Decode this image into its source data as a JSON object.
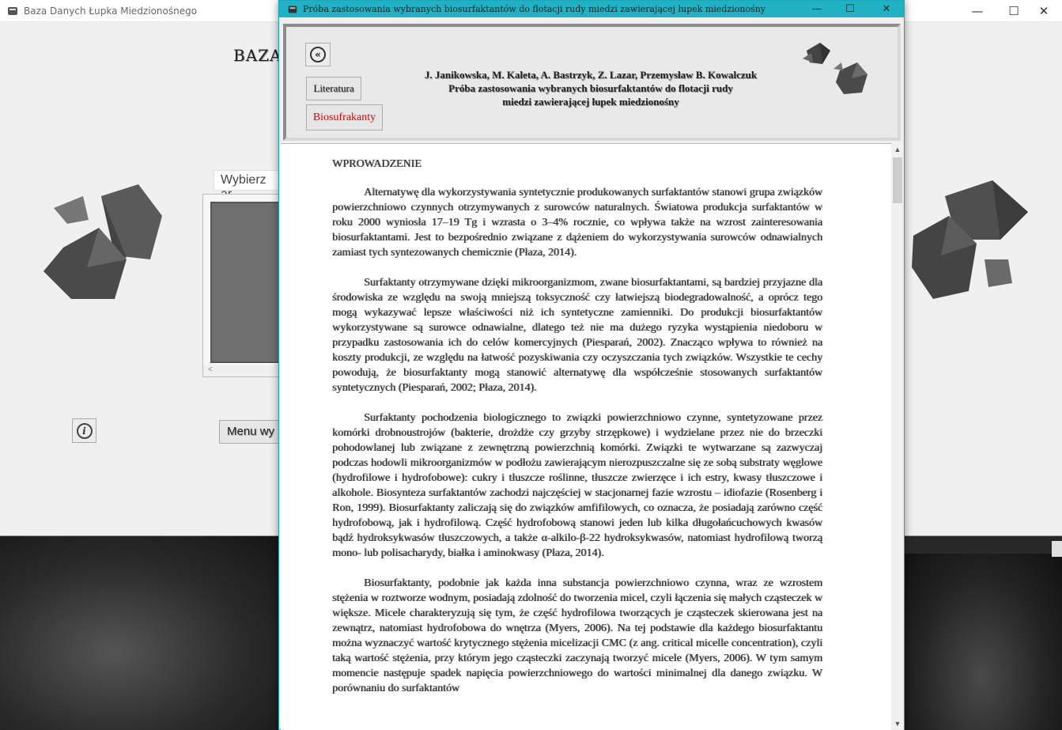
{
  "background_app": {
    "title": "Baza Danych Łupka Miedzionośnego",
    "heading": "BAZA",
    "select_text": "Wybierz ar",
    "menu_button": "Menu wy",
    "minimize": "—",
    "maximize": "☐",
    "close": "✕"
  },
  "dialog": {
    "title": "Próba zastosowania wybranych biosurfaktantów do flotacji rudy miedzi zawierającej łupek miedzionośny",
    "minimize": "—",
    "maximize": "☐",
    "close": "✕",
    "back_glyph": "«",
    "literatura_button": "Literatura",
    "biosurfaktanty_button": "Biosufrakanty",
    "authors": "J. Janikowska, M. Kaleta, A. Bastrzyk, Z. Lazar, Przemysław B. Kowalczuk",
    "paper_title_line1": "Próba zastosowania wybranych biosurfaktantów do flotacji rudy",
    "paper_title_line2": "miedzi zawierającej łupek miedzionośny",
    "accent_color": "#20b2c4"
  },
  "document": {
    "heading": "WPROWADZENIE",
    "paragraphs": [
      "Alternatywę dla wykorzystywania syntetycznie produkowanych surfaktantów stanowi grupa związków powierzchniowo czynnych otrzymywanych z surowców naturalnych. Światowa produkcja surfaktantów w roku 2000 wyniosła 17–19 Tg i wzrasta o 3–4% rocznie, co wpływa także na wzrost zainteresowania biosurfaktantami. Jest to bezpośrednio związane z dążeniem do wykorzystywania surowców odnawialnych zamiast tych syntezowanych chemicznie (Płaza, 2014).",
      "Surfaktanty otrzymywane dzięki mikroorganizmom, zwane biosurfaktantami, są bardziej przyjazne dla środowiska ze względu na swoją mniejszą toksyczność czy łatwiejszą biodegradowalność, a oprócz tego mogą wykazywać lepsze właściwości niż ich syntetyczne zamienniki. Do produkcji biosurfaktantów wykorzystywane są surowce odnawialne, dlatego też nie ma dużego ryzyka wystąpienia niedoboru w przypadku zastosowania ich do celów komercyjnych (Piesparań, 2002). Znacząco wpływa to również na koszty produkcji, ze względu na łatwość pozyskiwania czy oczyszczania tych związków. Wszystkie te cechy powodują, że biosurfaktanty mogą stanowić alternatywę dla współcześnie stosowanych surfaktantów syntetycznych (Piesparań, 2002; Płaza, 2014).",
      "Surfaktanty pochodzenia biologicznego to związki powierzchniowo czynne, syntetyzowane przez komórki drobnoustrojów (bakterie, drożdże czy grzyby strzępkowe) i wydzielane przez nie do brzeczki pohodowlanej lub związane z zewnętrzną powierzchnią komórki. Związki te wytwarzane są zazwyczaj podczas hodowli mikroorganizmów w podłożu zawierającym nierozpuszczalne się ze sobą substraty węglowe (hydrofilowe i hydrofobowe): cukry i tłuszcze roślinne, tłuszcze zwierzęce i ich estry, kwasy tłuszczowe i alkohole. Biosynteza surfaktantów zachodzi najczęściej w stacjonarnej fazie wzrostu – idiofazie (Rosenberg i Ron, 1999). Biosurfaktanty zaliczają się do związków amfifilowych, co oznacza, że posiadają zarówno część hydrofobową, jak i hydrofilową. Część hydrofobową stanowi jeden lub kilka długołańcuchowych kwasów bądź hydroksykwasów tłuszczowych, a także α-alkilo-β-22 hydroksykwasów, natomiast hydrofilową tworzą mono- lub polisacharydy, białka i aminokwasy (Płaza, 2014).",
      "Biosurfaktanty, podobnie jak każda inna substancja powierzchniowo czynna, wraz ze wzrostem stężenia w roztworze wodnym, posiadają zdolność do tworzenia micel, czyli łączenia się małych cząsteczek w większe. Micele charakteryzują się tym, że część hydrofilowa tworzących je cząsteczek skierowana jest na zewnątrz, natomiast hydrofobowa do wnętrza (Myers, 2006). Na tej podstawie dla każdego biosurfaktantu można wyznaczyć wartość krytycznego stężenia micelizacji CMC (z ang. critical micelle concentration), czyli taką wartość stężenia, przy którym jego cząsteczki zaczynają tworzyć micele (Myers, 2006). W tym samym momencie następuje spadek napięcia powierzchniowego do wartości minimalnej dla danego związku. W porównaniu do surfaktantów"
    ]
  }
}
